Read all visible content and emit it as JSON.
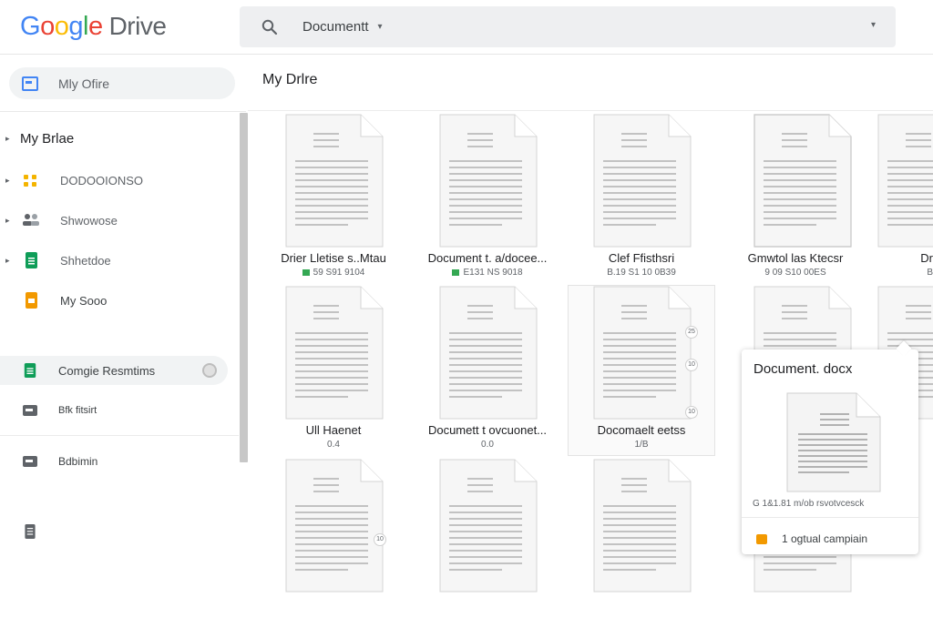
{
  "header": {
    "logo": {
      "letters": [
        "G",
        "o",
        "o",
        "g",
        "l",
        "e"
      ],
      "product": "Drive"
    },
    "search": {
      "value": "Documentt",
      "caret_glyph": "▾",
      "dropdown_glyph": "▾"
    }
  },
  "sidebar": {
    "my_drive_pill": "Mly Ofire",
    "tree_root": {
      "label": "My Brlae",
      "arrow": "▸"
    },
    "tree_items": [
      {
        "label": "DODOOIONSO",
        "icon": "shared-folder-icon",
        "color": "#f4b400",
        "arrow": "▸"
      },
      {
        "label": "Shwowose",
        "icon": "people-icon",
        "color": "#5f6368",
        "arrow": "▸"
      },
      {
        "label": "Shhetdoe",
        "icon": "sheets-icon",
        "color": "#0f9d58",
        "arrow": "▸"
      },
      {
        "label": "My Sooo",
        "icon": "slides-icon",
        "color": "#f29900",
        "arrow": ""
      }
    ],
    "nav_items": [
      {
        "label": "Comgie Resmtims",
        "icon": "sheets-icon",
        "color": "#0f9d58",
        "active": true
      },
      {
        "label": "Bfk fitsirt",
        "icon": "storage-icon",
        "color": "#5f6368",
        "active": false
      },
      {
        "label": "Bdbimin",
        "icon": "storage-icon",
        "color": "#5f6368",
        "active": false
      },
      {
        "label": "",
        "icon": "document-icon",
        "color": "#5f6368",
        "active": false
      }
    ]
  },
  "main": {
    "title": "My Drlre",
    "files": [
      {
        "name": "Drier Lletise s..Mtau",
        "meta": "59 S91 9104",
        "meta_icon": true
      },
      {
        "name": "Document t. a/docee...",
        "meta": "E131 NS 9018",
        "meta_icon": true
      },
      {
        "name": "Clef Ffisthsri",
        "meta": "B.19 S1 10 0B39",
        "meta_icon": false
      },
      {
        "name": "Gmwtol las Ktecsr",
        "meta": "9 09 S10 00ES",
        "meta_icon": false
      },
      {
        "name": "Dr",
        "meta": "B",
        "meta_icon": false
      },
      {
        "name": "Ull Haenet",
        "meta": "0.4",
        "meta_icon": false
      },
      {
        "name": "Documett t ovcuonet...",
        "meta": "0.0",
        "meta_icon": false
      },
      {
        "name": "Docomaelt eetss",
        "meta": "1/B",
        "meta_icon": false
      },
      {
        "name": "",
        "meta": "",
        "meta_icon": false
      },
      {
        "name": "",
        "meta": "",
        "meta_icon": false
      },
      {
        "name": "",
        "meta": "",
        "meta_icon": false
      },
      {
        "name": "",
        "meta": "",
        "meta_icon": false
      },
      {
        "name": "",
        "meta": "",
        "meta_icon": false
      },
      {
        "name": "",
        "meta": "",
        "meta_icon": false
      }
    ],
    "side_markers": [
      "25",
      "10",
      "10",
      "10"
    ]
  },
  "popover": {
    "title": "Document. docx",
    "meta": "G  1&1.81 m/ob rsvotvcesck",
    "action_label": "1 ogtual campiain"
  }
}
